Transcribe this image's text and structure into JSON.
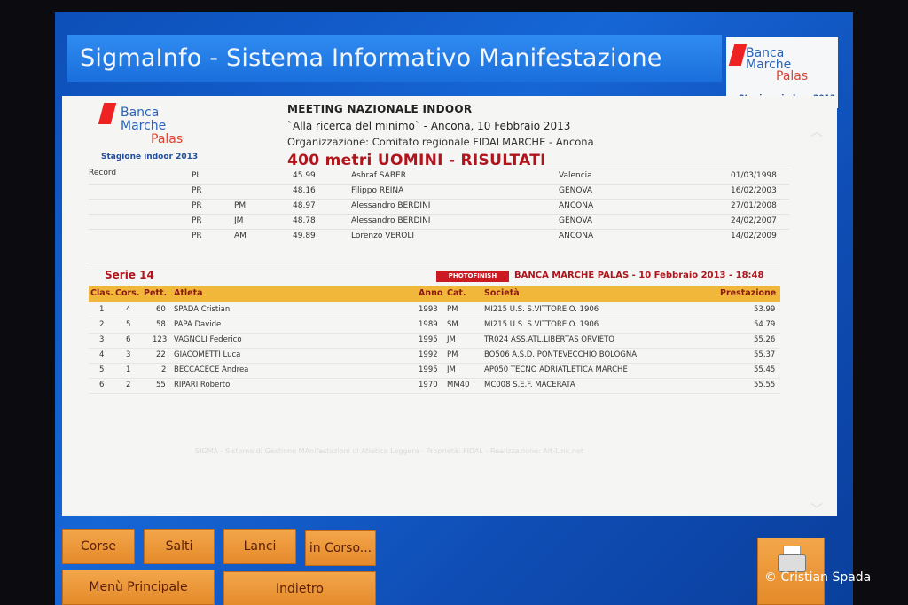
{
  "window": {
    "title": "SigmaInfo - Sistema Informativo Manifestazione"
  },
  "logo": {
    "line1": "Banca",
    "line2": "Marche",
    "line3": "Palas",
    "subtitle": "Stagione indoor 2013"
  },
  "meeting": {
    "title": "MEETING NAZIONALE INDOOR",
    "subtitle": "`Alla ricerca del minimo` - Ancona, 10 Febbraio 2013",
    "organizer": "Organizzazione: Comitato regionale FIDALMARCHE - Ancona",
    "event": "400 metri UOMINI - RISULTATI"
  },
  "records": {
    "label": "Record",
    "rows": [
      {
        "type": "PI",
        "cat": "",
        "time": "45.99",
        "athlete": "Ashraf SABER",
        "place": "Valencia",
        "date": "01/03/1998"
      },
      {
        "type": "PR",
        "cat": "",
        "time": "48.16",
        "athlete": "Filippo REINA",
        "place": "GENOVA",
        "date": "16/02/2003"
      },
      {
        "type": "PR",
        "cat": "PM",
        "time": "48.97",
        "athlete": "Alessandro BERDINI",
        "place": "ANCONA",
        "date": "27/01/2008"
      },
      {
        "type": "PR",
        "cat": "JM",
        "time": "48.78",
        "athlete": "Alessandro BERDINI",
        "place": "GENOVA",
        "date": "24/02/2007"
      },
      {
        "type": "PR",
        "cat": "AM",
        "time": "49.89",
        "athlete": "Lorenzo VEROLI",
        "place": "ANCONA",
        "date": "14/02/2009"
      }
    ]
  },
  "serie": {
    "title": "Serie 14",
    "badge": "PHOTOFINISH",
    "info": "BANCA MARCHE PALAS - 10 Febbraio 2013 - 18:48"
  },
  "results": {
    "headers": {
      "clas": "Clas.",
      "cors": "Cors.",
      "pett": "Pett.",
      "atleta": "Atleta",
      "anno": "Anno",
      "cat": "Cat.",
      "societa": "Società",
      "prestazione": "Prestazione"
    },
    "rows": [
      {
        "clas": "1",
        "cors": "4",
        "pett": "60",
        "atleta": "SPADA Cristian",
        "anno": "1993",
        "cat": "PM",
        "societa": "MI215 U.S. S.VITTORE O. 1906",
        "prestazione": "53.99"
      },
      {
        "clas": "2",
        "cors": "5",
        "pett": "58",
        "atleta": "PAPA Davide",
        "anno": "1989",
        "cat": "SM",
        "societa": "MI215 U.S. S.VITTORE O. 1906",
        "prestazione": "54.79"
      },
      {
        "clas": "3",
        "cors": "6",
        "pett": "123",
        "atleta": "VAGNOLI Federico",
        "anno": "1995",
        "cat": "JM",
        "societa": "TR024 ASS.ATL.LIBERTAS ORVIETO",
        "prestazione": "55.26"
      },
      {
        "clas": "4",
        "cors": "3",
        "pett": "22",
        "atleta": "GIACOMETTI Luca",
        "anno": "1992",
        "cat": "PM",
        "societa": "BO506 A.S.D. PONTEVECCHIO BOLOGNA",
        "prestazione": "55.37"
      },
      {
        "clas": "5",
        "cors": "1",
        "pett": "2",
        "atleta": "BECCACECE Andrea",
        "anno": "1995",
        "cat": "JM",
        "societa": "AP050 TECNO ADRIATLETICA MARCHE",
        "prestazione": "55.45"
      },
      {
        "clas": "6",
        "cors": "2",
        "pett": "55",
        "atleta": "RIPARI Roberto",
        "anno": "1970",
        "cat": "MM40",
        "societa": "MC008 S.E.F. MACERATA",
        "prestazione": "55.55"
      }
    ]
  },
  "footer_note": "SIGMA - Sistema di Gestione MAnifestazioni di Atletica Leggera - Proprietà: FIDAL - Realizzazione: Alt-Link.net",
  "buttons": {
    "corse": "Corse",
    "salti": "Salti",
    "lanci": "Lanci",
    "in_corso": "in Corso...",
    "menu": "Menù Principale",
    "indietro": "Indietro"
  },
  "credit": "© Cristian Spada",
  "colors": {
    "accent_red": "#b0141c",
    "header_orange": "#f1b73a",
    "screen_blue": "#1666d6",
    "button_orange": "#e48a2a"
  }
}
